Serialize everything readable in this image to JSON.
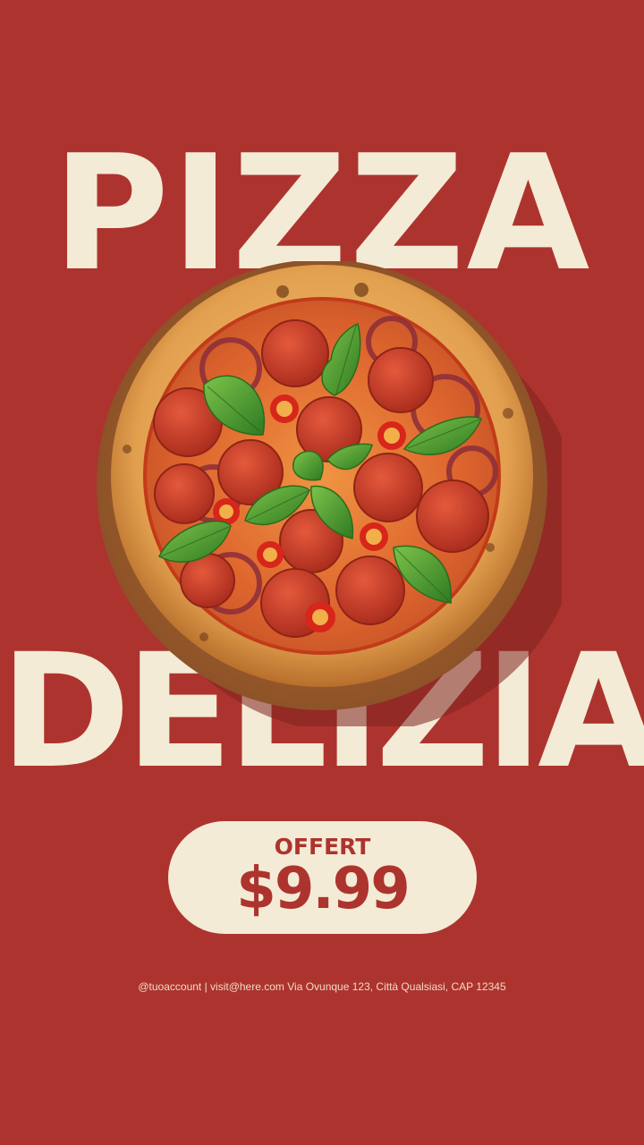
{
  "poster": {
    "headline_top": "PIZZA",
    "headline_bottom": "DELIZIA",
    "image_description_name": "pepperoni-pizza",
    "offer": {
      "label": "OFFERT",
      "price": "$9.99"
    },
    "contact": "@tuoaccount | visit@here.com Via Ovunque 123, Città Qualsiasi, CAP 12345"
  },
  "colors": {
    "background": "#ad342e",
    "headline": "#f4ebd6",
    "pill": "#f4ebd6",
    "accent_text": "#ad342e"
  }
}
